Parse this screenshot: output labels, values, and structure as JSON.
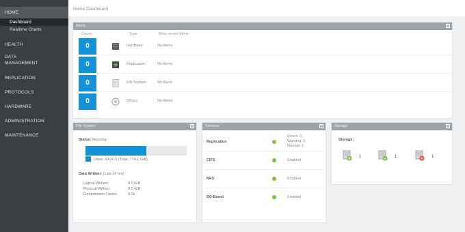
{
  "sidebar": {
    "home": "HOME",
    "dashboard": "Dashboard",
    "realtime_charts": "Realtime Charts",
    "health": "HEALTH",
    "data_management_1": "DATA",
    "data_management_2": "MANAGEMENT",
    "replication": "REPLICATION",
    "protocols": "PROTOCOLS",
    "hardware": "HARDWARE",
    "administration": "ADMINISTRATION",
    "maintenance": "MAINTENANCE"
  },
  "breadcrumb": "Home Dashboard",
  "alerts": {
    "title": "Alerts",
    "col_count": "Count",
    "col_type": "Type",
    "col_recent": "Most recent Alerts",
    "rows": [
      {
        "count": "0",
        "type": "Hardware",
        "alert": "No Alerts",
        "icon": "hardware-icon"
      },
      {
        "count": "0",
        "type": "Replication",
        "alert": "No Alerts",
        "icon": "replication-icon"
      },
      {
        "count": "0",
        "type": "File System",
        "alert": "No Alerts",
        "icon": "file-system-icon"
      },
      {
        "count": "0",
        "type": "Others",
        "alert": "No Alerts",
        "icon": "others-icon"
      }
    ]
  },
  "file_system": {
    "title": "File System",
    "status_label": "Status:",
    "status_value": "Running",
    "used_text": "Used: XX(4.7) (Total: 774.1 GiB)",
    "usage_fraction": 0.6,
    "data_written_label": "Data Written:",
    "data_written_period": "(Last 24 hrs)",
    "logical_label": "Logical Written:",
    "logical_value": "0.0 GiB",
    "physical_label": "Physical Written:",
    "physical_value": "0.0 GiB",
    "compression_label": "Compression Factor:",
    "compression_value": "0.0x"
  },
  "services": {
    "title": "Services",
    "rows": [
      {
        "name": "Replication",
        "status_lines": [
          "Errors: 0",
          "Warning: 0",
          "Normal: 1"
        ]
      },
      {
        "name": "CIFS",
        "status_lines": [
          "Enabled"
        ]
      },
      {
        "name": "NFS",
        "status_lines": [
          "Enabled"
        ]
      },
      {
        "name": "DD Boost",
        "status_lines": [
          "Enabled"
        ]
      }
    ]
  },
  "storage": {
    "title": "Storage",
    "label": "Storage:",
    "items": [
      {
        "count": "1",
        "icon": "storage-add-icon"
      },
      {
        "count": "1",
        "icon": "storage-ok-icon"
      },
      {
        "count": "1",
        "icon": "storage-error-icon"
      }
    ]
  },
  "colors": {
    "sidebar_bg": "#3b3e42",
    "accent_blue": "#1592d6",
    "status_green": "#7cc142",
    "error_red": "#e0413a"
  }
}
